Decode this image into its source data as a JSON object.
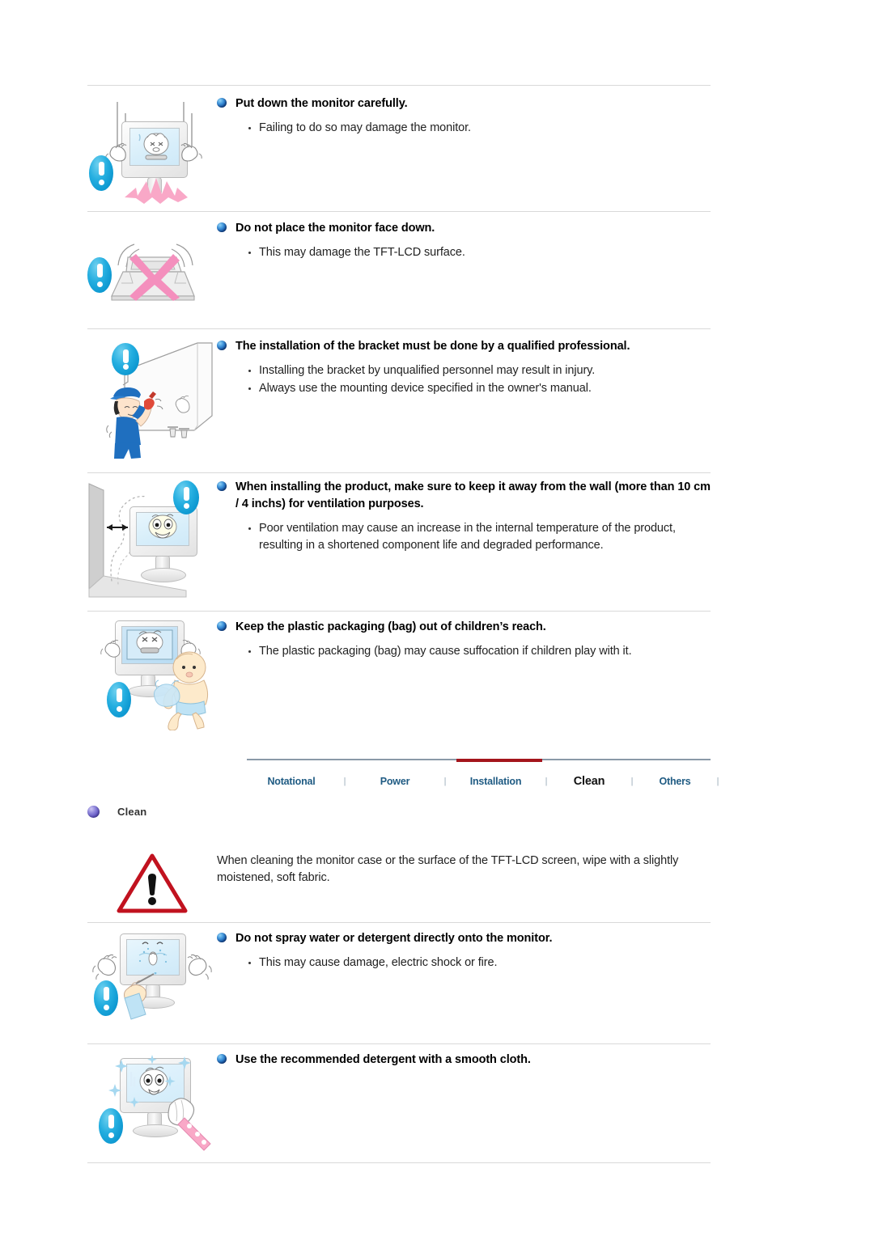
{
  "document": {
    "title": "Safety Instructions - Installation / Clean"
  },
  "sections": [
    {
      "id": "put-down-monitor",
      "icon": "monitor-dropped-icon",
      "heading": "Put down the monitor carefully.",
      "bullets": [
        "Failing to do so may damage the monitor."
      ]
    },
    {
      "id": "face-down",
      "icon": "monitor-face-down-icon",
      "heading": "Do not place the monitor face down.",
      "bullets": [
        "This may damage the TFT-LCD surface."
      ]
    },
    {
      "id": "bracket-install",
      "icon": "wall-bracket-installer-icon",
      "heading": "The installation of the bracket must be done by a qualified professional.",
      "bullets": [
        "Installing the bracket by unqualified personnel may result in injury.",
        "Always use the mounting device specified in the owner's manual."
      ]
    },
    {
      "id": "wall-clearance",
      "icon": "monitor-wall-clearance-icon",
      "heading": "When installing the product, make sure to keep it away from the wall (more than 10 cm / 4 inchs) for ventilation purposes.",
      "bullets": [
        "Poor ventilation may cause an increase in the internal temperature of the product, resulting in a shortened component life and degraded performance."
      ]
    },
    {
      "id": "plastic-bag",
      "icon": "baby-plastic-bag-icon",
      "heading": "Keep the plastic packaging (bag) out of children’s reach.",
      "bullets": [
        "The plastic packaging (bag) may cause suffocation if children play with it."
      ]
    }
  ],
  "nav": {
    "tabs": [
      {
        "label": "Notational",
        "active": false
      },
      {
        "label": "Power",
        "active": false
      },
      {
        "label": "Installation",
        "active": false
      },
      {
        "label": "Clean",
        "active": true
      },
      {
        "label": "Others",
        "active": false
      }
    ],
    "separator": "|",
    "active_color": "#a4151c",
    "link_color": "#1f5b83"
  },
  "clean_section": {
    "label": "Clean",
    "note": "When cleaning the monitor case or the surface of the TFT-LCD screen, wipe with a slightly moistened, soft fabric.",
    "note_icon": "warning-triangle-icon",
    "items": [
      {
        "id": "no-spray",
        "icon": "monitor-spray-warning-icon",
        "heading": "Do not spray water or detergent directly onto the monitor.",
        "bullets": [
          "This may cause damage, electric shock or fire."
        ]
      },
      {
        "id": "use-detergent",
        "icon": "monitor-wipe-cloth-icon",
        "heading": "Use the recommended detergent with a smooth cloth.",
        "bullets": []
      }
    ]
  },
  "colors": {
    "heading_text": "#000000",
    "body_text": "#222222",
    "rule": "#d9d9d9",
    "warning_red": "#c1121f",
    "icon_blue": "#14a3d6",
    "accent_pink": "#f49ac1",
    "tab_line": "#8a99a8"
  }
}
